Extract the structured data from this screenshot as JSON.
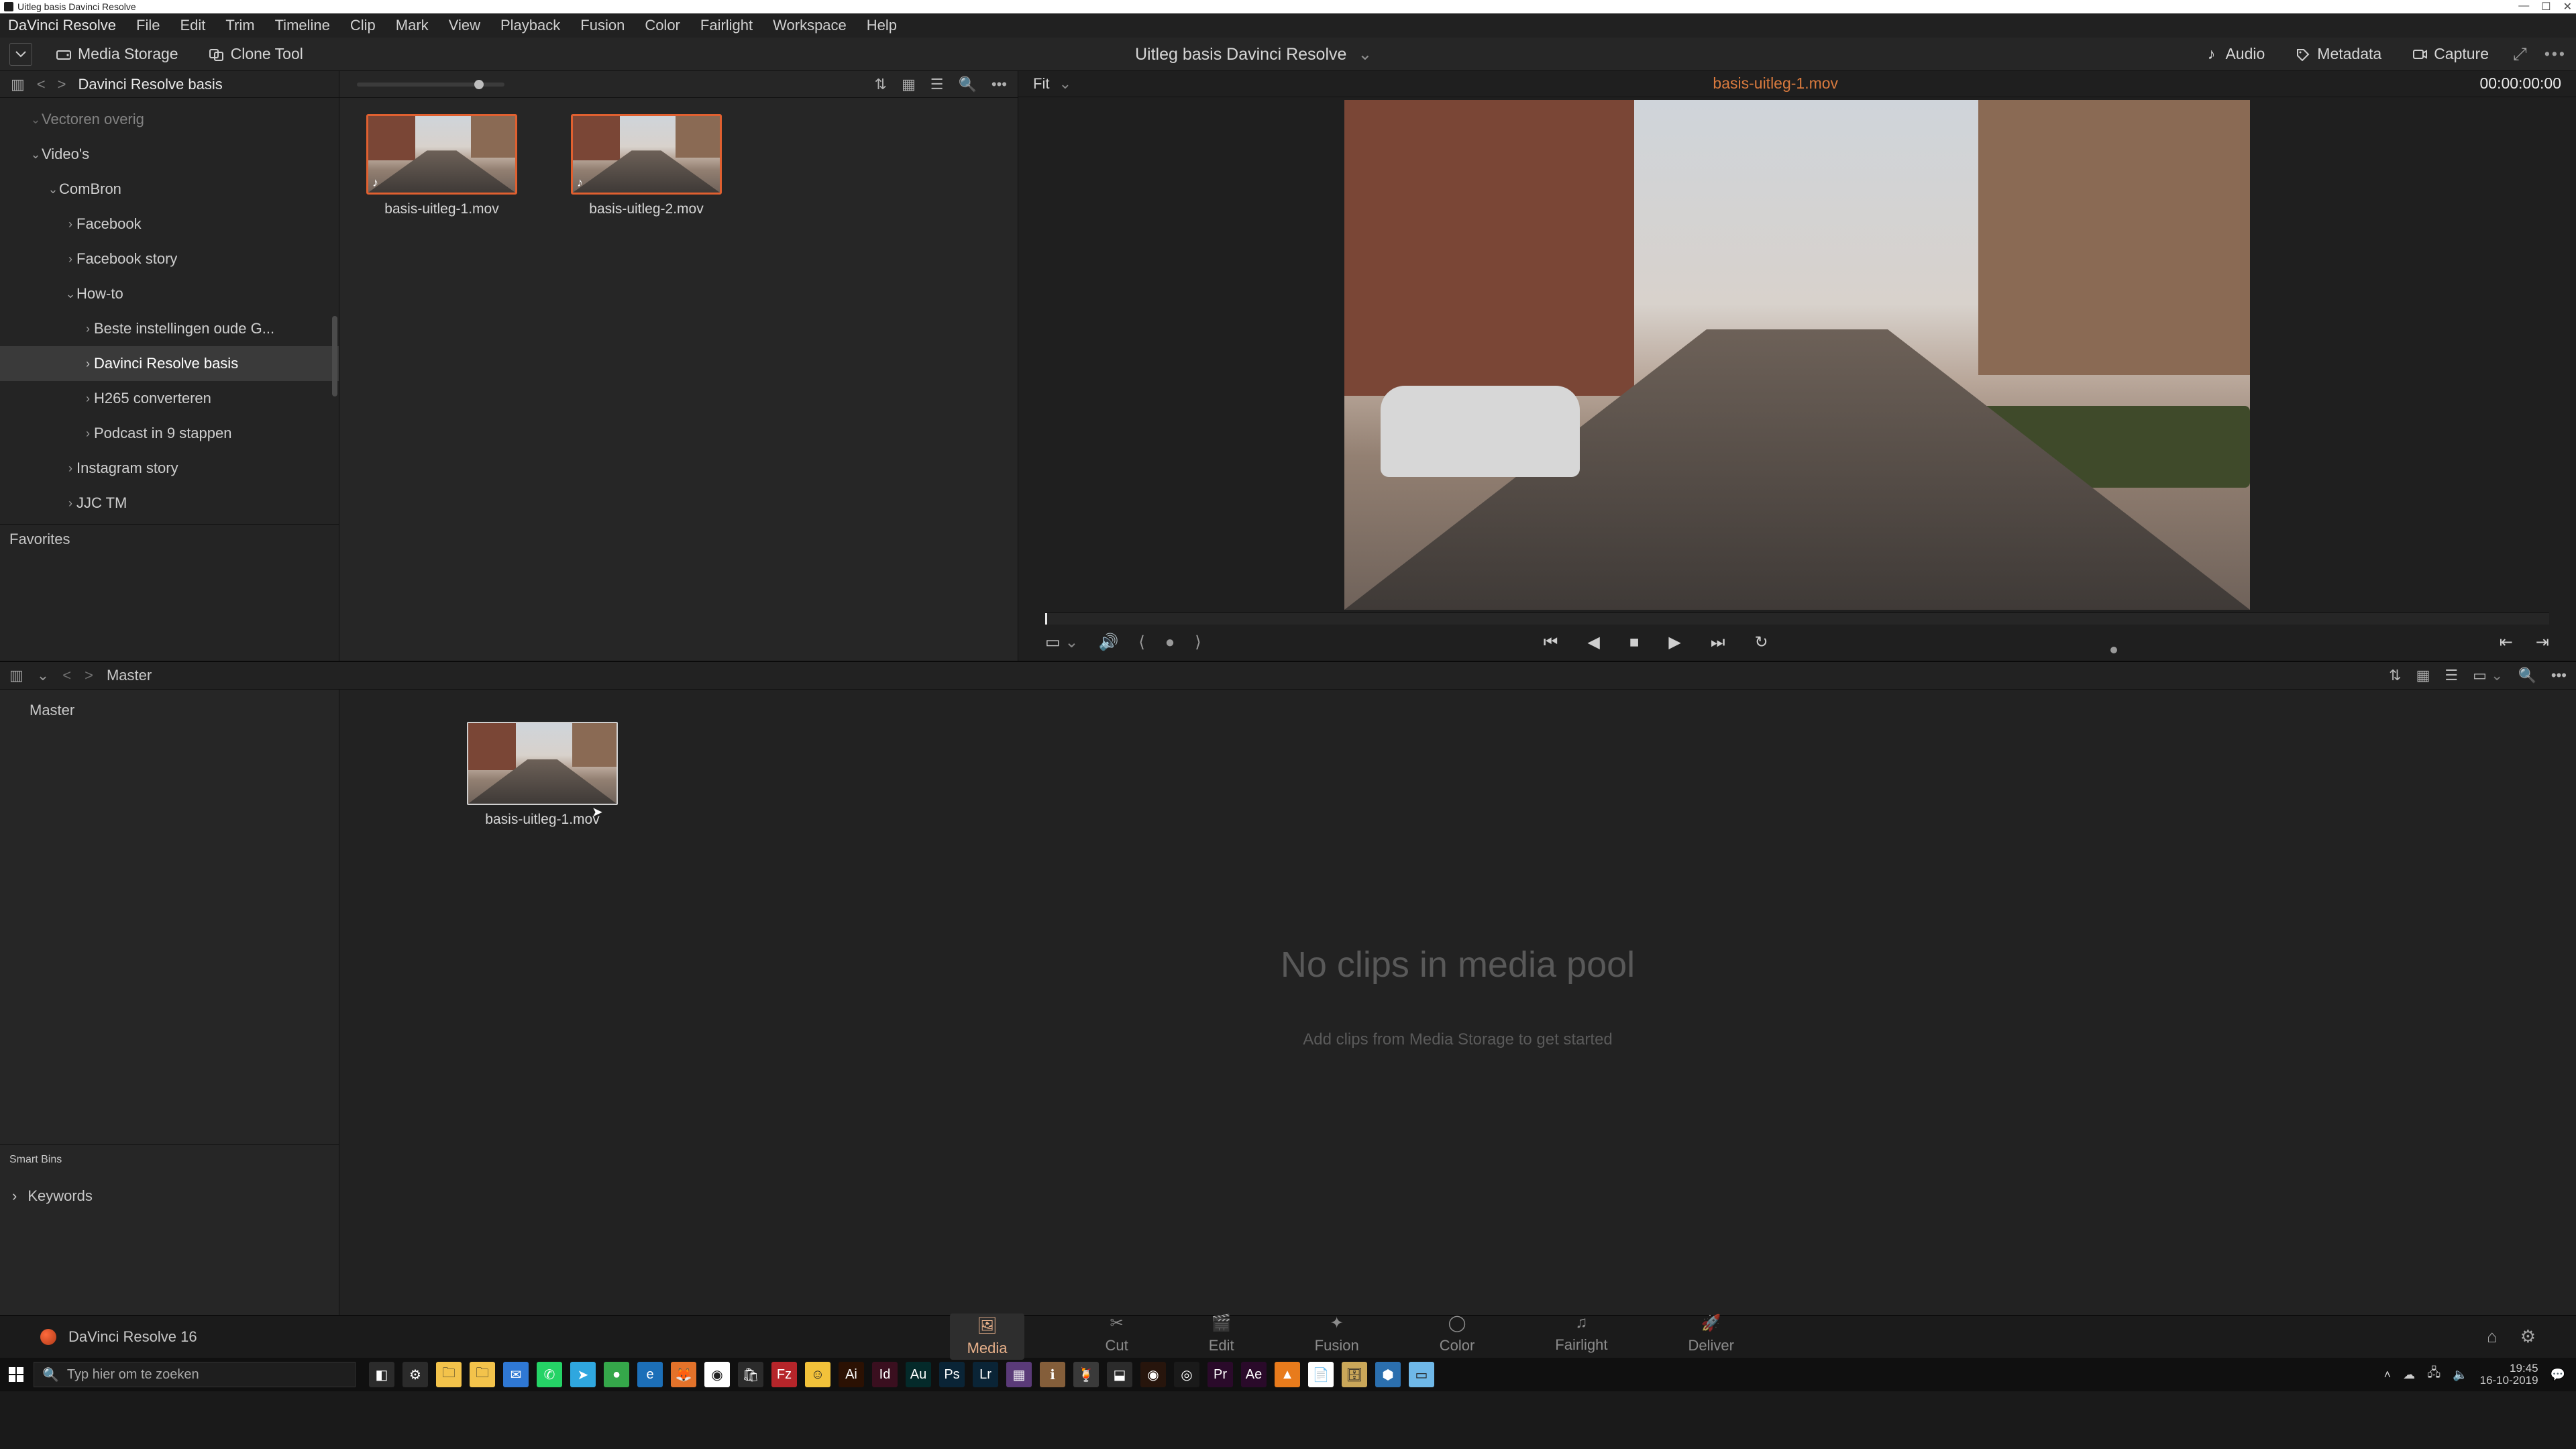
{
  "window": {
    "title": "Uitleg basis Davinci Resolve"
  },
  "menus": [
    "DaVinci Resolve",
    "File",
    "Edit",
    "Trim",
    "Timeline",
    "Clip",
    "Mark",
    "View",
    "Playback",
    "Fusion",
    "Color",
    "Fairlight",
    "Workspace",
    "Help"
  ],
  "toolbar": {
    "media_storage": "Media Storage",
    "clone_tool": "Clone Tool",
    "project": "Uitleg basis Davinci Resolve",
    "audio": "Audio",
    "metadata": "Metadata",
    "capture": "Capture"
  },
  "browser": {
    "path": "Davinci Resolve basis",
    "favorites_label": "Favorites",
    "tree": [
      {
        "depth": 1,
        "caret": "v",
        "label": "Vectoren overig",
        "sel": false,
        "faded": true
      },
      {
        "depth": 1,
        "caret": "v",
        "label": "Video's",
        "sel": false
      },
      {
        "depth": 2,
        "caret": "v",
        "label": "ComBron",
        "sel": false
      },
      {
        "depth": 3,
        "caret": ">",
        "label": "Facebook",
        "sel": false
      },
      {
        "depth": 3,
        "caret": ">",
        "label": "Facebook story",
        "sel": false
      },
      {
        "depth": 3,
        "caret": "v",
        "label": "How-to",
        "sel": false
      },
      {
        "depth": 4,
        "caret": ">",
        "label": "Beste instellingen oude G...",
        "sel": false
      },
      {
        "depth": 4,
        "caret": ">",
        "label": "Davinci Resolve basis",
        "sel": true
      },
      {
        "depth": 4,
        "caret": ">",
        "label": "H265 converteren",
        "sel": false
      },
      {
        "depth": 4,
        "caret": ">",
        "label": "Podcast in 9 stappen",
        "sel": false
      },
      {
        "depth": 3,
        "caret": ">",
        "label": "Instagram story",
        "sel": false
      },
      {
        "depth": 3,
        "caret": ">",
        "label": "JJC TM",
        "sel": false
      }
    ],
    "clips": [
      {
        "name": "basis-uitleg-1.mov"
      },
      {
        "name": "basis-uitleg-2.mov"
      }
    ]
  },
  "viewer": {
    "fit_label": "Fit",
    "clip_name": "basis-uitleg-1.mov",
    "timecode": "00:00:00:00"
  },
  "mediapool": {
    "breadcrumb": "Master",
    "root_bin": "Master",
    "smart_bins_label": "Smart Bins",
    "keywords_label": "Keywords",
    "empty_big": "No clips in media pool",
    "empty_sub": "Add clips from Media Storage to get started",
    "drag_clip": "basis-uitleg-1.mov"
  },
  "pages": {
    "product": "DaVinci Resolve 16",
    "items": [
      {
        "id": "media",
        "label": "Media",
        "active": true
      },
      {
        "id": "cut",
        "label": "Cut"
      },
      {
        "id": "edit",
        "label": "Edit"
      },
      {
        "id": "fusion",
        "label": "Fusion"
      },
      {
        "id": "color",
        "label": "Color"
      },
      {
        "id": "fairlight",
        "label": "Fairlight"
      },
      {
        "id": "deliver",
        "label": "Deliver"
      }
    ]
  },
  "taskbar": {
    "search_placeholder": "Typ hier om te zoeken",
    "time": "19:45",
    "date": "16-10-2019",
    "apps": [
      {
        "n": "task-view",
        "bg": "#2b2b2b",
        "g": "◧"
      },
      {
        "n": "settings",
        "bg": "#2b2b2b",
        "g": "⚙"
      },
      {
        "n": "explorer",
        "bg": "#f3c34b",
        "g": "🗀"
      },
      {
        "n": "explorer-2",
        "bg": "#f3c34b",
        "g": "🗀"
      },
      {
        "n": "mail",
        "bg": "#2f78d4",
        "g": "✉"
      },
      {
        "n": "whatsapp",
        "bg": "#25d366",
        "g": "✆"
      },
      {
        "n": "telegram",
        "bg": "#2fa7df",
        "g": "➤"
      },
      {
        "n": "app-green",
        "bg": "#35a74a",
        "g": "●"
      },
      {
        "n": "edge",
        "bg": "#1c6fb8",
        "g": "e"
      },
      {
        "n": "firefox",
        "bg": "#e3722a",
        "g": "🦊"
      },
      {
        "n": "chrome",
        "bg": "#ffffff",
        "g": "◉"
      },
      {
        "n": "ms-store",
        "bg": "#2b2b2b",
        "g": "🛍"
      },
      {
        "n": "filezilla",
        "bg": "#b6252a",
        "g": "Fz"
      },
      {
        "n": "app-yellow",
        "bg": "#f2c23a",
        "g": "☺"
      },
      {
        "n": "adobe-ai",
        "bg": "#2b1103",
        "g": "Ai"
      },
      {
        "n": "adobe-id",
        "bg": "#3a0f1f",
        "g": "Id"
      },
      {
        "n": "adobe-au",
        "bg": "#042a2a",
        "g": "Au"
      },
      {
        "n": "adobe-ps",
        "bg": "#0a2436",
        "g": "Ps"
      },
      {
        "n": "adobe-lr",
        "bg": "#0a2436",
        "g": "Lr"
      },
      {
        "n": "app-mosaic",
        "bg": "#5a3a78",
        "g": "▦"
      },
      {
        "n": "mediainfo",
        "bg": "#845e3a",
        "g": "ℹ"
      },
      {
        "n": "handbrake",
        "bg": "#3a3a3a",
        "g": "🍹"
      },
      {
        "n": "wacom",
        "bg": "#2b2b2b",
        "g": "⬓"
      },
      {
        "n": "resolve-tb",
        "bg": "#27150c",
        "g": "◉"
      },
      {
        "n": "obs",
        "bg": "#1a1a1a",
        "g": "◎"
      },
      {
        "n": "adobe-pr",
        "bg": "#2a0a2a",
        "g": "Pr"
      },
      {
        "n": "adobe-ae",
        "bg": "#2a0a2a",
        "g": "Ae"
      },
      {
        "n": "vlc",
        "bg": "#e87b1c",
        "g": "▲"
      },
      {
        "n": "notes",
        "bg": "#ffffff",
        "g": "📄"
      },
      {
        "n": "archive",
        "bg": "#caa759",
        "g": "🗄"
      },
      {
        "n": "maps",
        "bg": "#2b6fae",
        "g": "⬢"
      },
      {
        "n": "app-sky",
        "bg": "#6fb8e8",
        "g": "▭"
      }
    ]
  }
}
